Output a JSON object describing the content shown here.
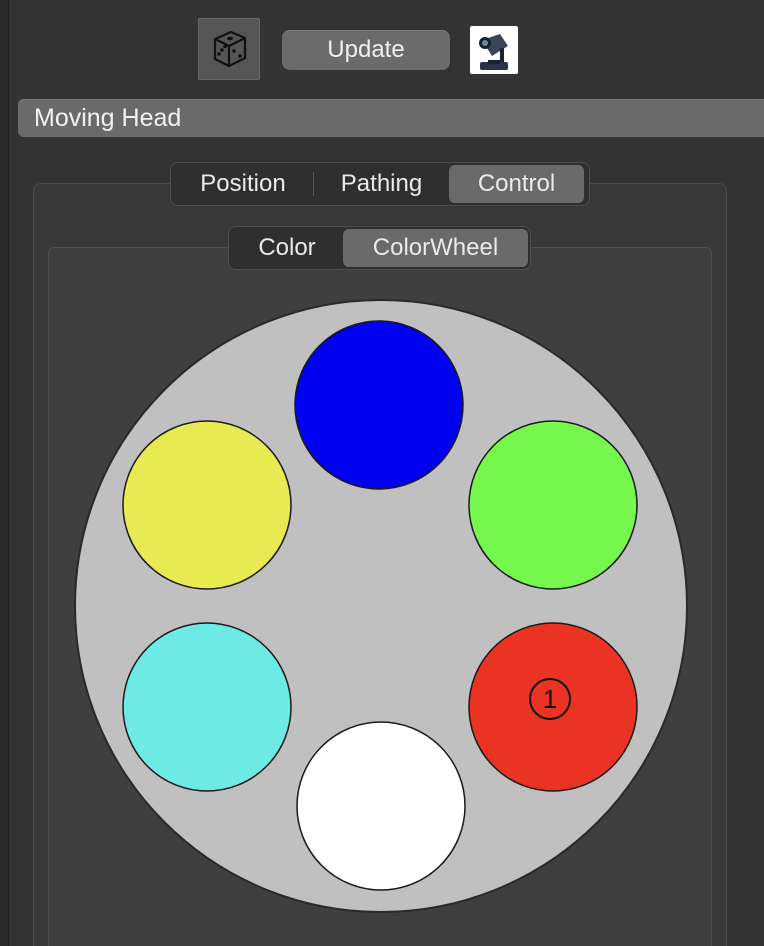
{
  "toolbar": {
    "dice_icon": "dice-icon",
    "update_label": "Update",
    "fixture_icon": "moving-head-fixture-icon"
  },
  "model": {
    "label": "Moving Head"
  },
  "outer_tabs": [
    {
      "label": "Position",
      "active": false
    },
    {
      "label": "Pathing",
      "active": false
    },
    {
      "label": "Control",
      "active": true
    }
  ],
  "inner_tabs": [
    {
      "label": "Color",
      "active": false
    },
    {
      "label": "ColorWheel",
      "active": true
    }
  ],
  "color_wheel": {
    "background": "#c0c0c0",
    "slots": [
      {
        "color": "#0000f0",
        "label": ""
      },
      {
        "color": "#76f74d",
        "label": ""
      },
      {
        "color": "#ea3323",
        "label": "1"
      },
      {
        "color": "#ffffff",
        "label": ""
      },
      {
        "color": "#6deae4",
        "label": ""
      },
      {
        "color": "#e8ea52",
        "label": ""
      }
    ]
  }
}
